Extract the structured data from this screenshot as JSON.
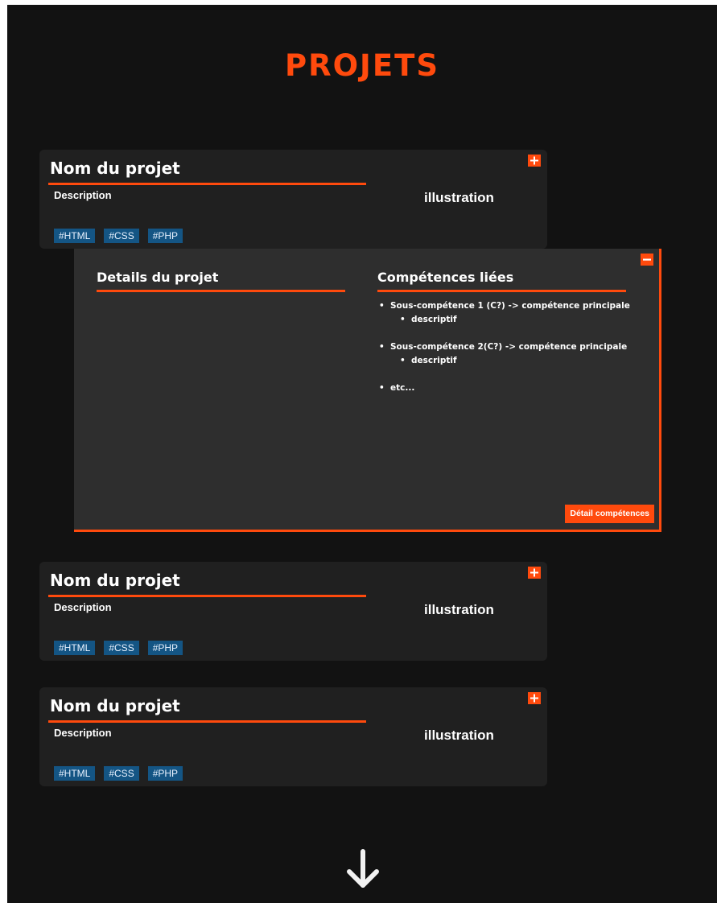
{
  "page": {
    "title": "PROJETS"
  },
  "projects": [
    {
      "name": "Nom du projet",
      "description": "Description",
      "illustration": "illustration",
      "tags": [
        "#HTML",
        "#CSS",
        "#PHP"
      ],
      "toggle_icon": "plus-icon"
    },
    {
      "name": "Nom du projet",
      "description": "Description",
      "illustration": "illustration",
      "tags": [
        "#HTML",
        "#CSS",
        "#PHP"
      ],
      "toggle_icon": "plus-icon"
    },
    {
      "name": "Nom du projet",
      "description": "Description",
      "illustration": "illustration",
      "tags": [
        "#HTML",
        "#CSS",
        "#PHP"
      ],
      "toggle_icon": "plus-icon"
    }
  ],
  "detail_panel": {
    "details_title": "Details du projet",
    "skills_title": "Compétences liées",
    "skills": [
      {
        "label": "Sous-compétence 1 (C?) -> compétence principale",
        "sub": "descriptif"
      },
      {
        "label": "Sous-compétence 2(C?) -> compétence principale",
        "sub": "descriptif"
      },
      {
        "label": "etc..."
      }
    ],
    "button_label": "Détail compétences",
    "toggle_icon": "minus-icon"
  },
  "footer": {
    "scroll_icon": "arrow-down-icon"
  },
  "colors": {
    "accent": "#ff4a0d",
    "background": "#121212",
    "card": "#202020",
    "panel": "#2e2e2e",
    "tag": "#145584"
  }
}
